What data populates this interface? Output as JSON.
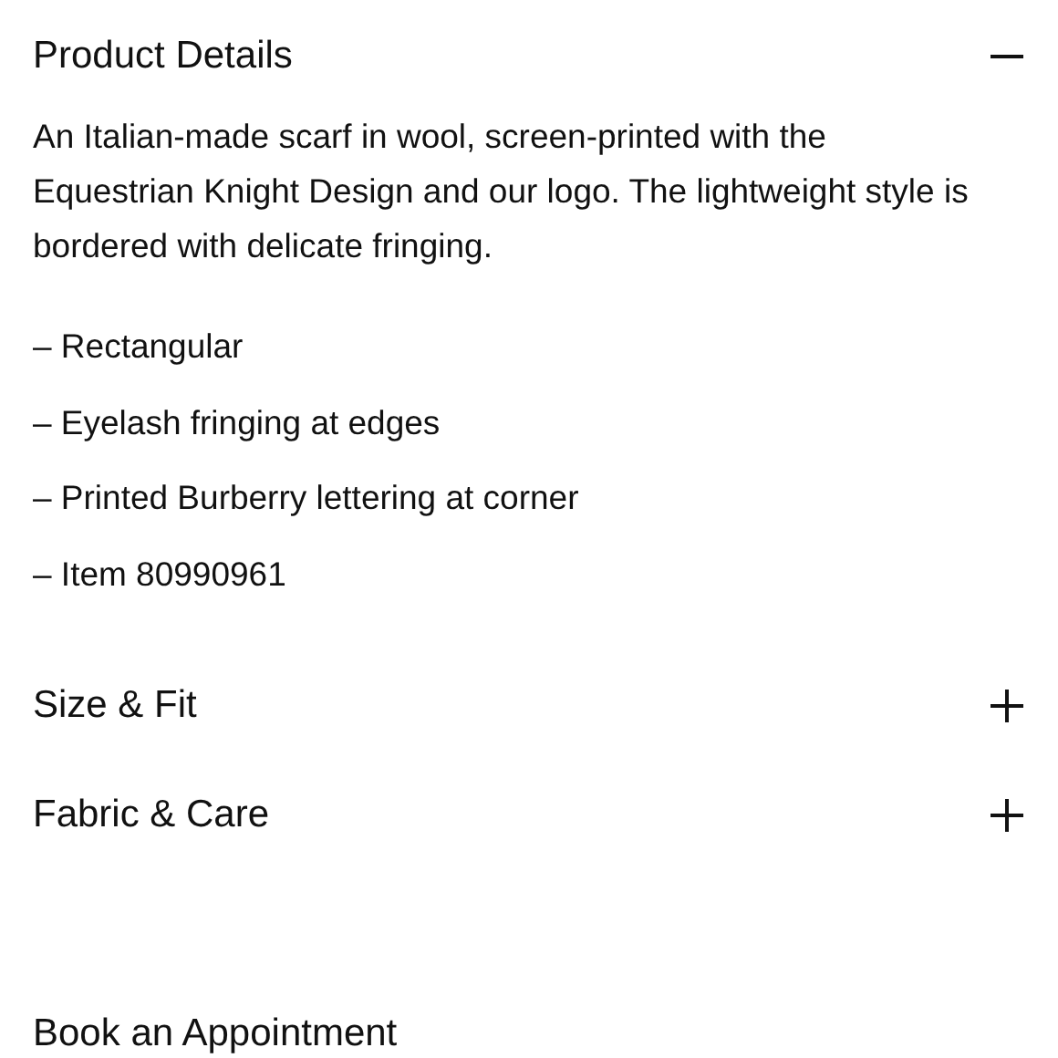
{
  "sections": [
    {
      "title": "Product Details",
      "expanded": true,
      "description": "An Italian-made scarf in wool, screen-printed with the Equestrian Knight Design and our logo. The lightweight style is bordered with delicate fringing.",
      "bullets": [
        "– Rectangular",
        "– Eyelash fringing at edges",
        "– Printed Burberry lettering at corner",
        "– Item 80990961"
      ]
    },
    {
      "title": "Size & Fit",
      "expanded": false
    },
    {
      "title": "Fabric & Care",
      "expanded": false
    }
  ],
  "appointment": {
    "title": "Book an Appointment"
  }
}
